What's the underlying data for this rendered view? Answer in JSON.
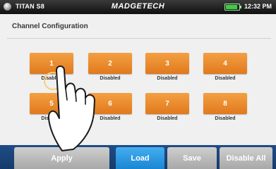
{
  "status_bar": {
    "device_name": "TITAN S8",
    "brand": "MADGETECH",
    "clock": "12:32 PM",
    "battery_level": 0.9
  },
  "page": {
    "title": "Channel Configuration"
  },
  "channels": [
    {
      "number": "1",
      "status": "Disabled"
    },
    {
      "number": "2",
      "status": "Disabled"
    },
    {
      "number": "3",
      "status": "Disabled"
    },
    {
      "number": "4",
      "status": "Disabled"
    },
    {
      "number": "5",
      "status": "Disabled"
    },
    {
      "number": "6",
      "status": "Disabled"
    },
    {
      "number": "7",
      "status": "Disabled"
    },
    {
      "number": "8",
      "status": "Disabled"
    }
  ],
  "toolbar": {
    "apply_label": "Apply",
    "load_label": "Load",
    "save_label": "Save",
    "disable_all_label": "Disable All"
  },
  "colors": {
    "channel_button": "#e98a2c",
    "load_button": "#2a97df",
    "bottom_bar": "#1b4478",
    "disabled_button": "#b9b9b9"
  },
  "icons": {
    "device": "device-dot-icon",
    "battery": "battery-icon",
    "pointer": "pointing-hand-icon"
  }
}
